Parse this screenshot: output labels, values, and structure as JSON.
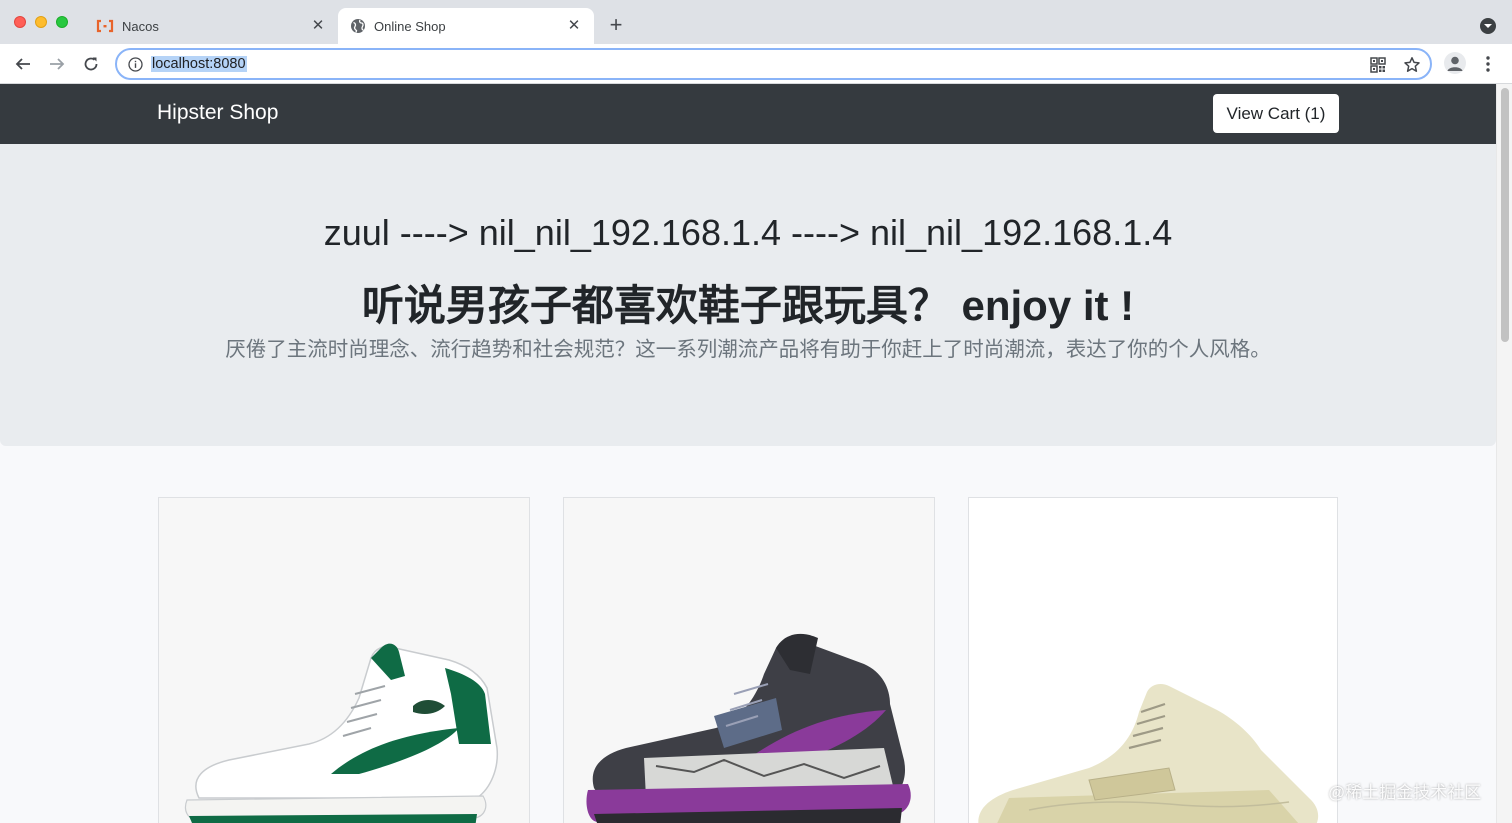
{
  "browser": {
    "tabs": [
      {
        "label": "Nacos",
        "icon": "nacos-logo-icon",
        "active": false
      },
      {
        "label": "Online Shop",
        "icon": "globe-icon",
        "active": true
      }
    ],
    "address_bar": {
      "url": "localhost:8080"
    }
  },
  "navbar": {
    "brand": "Hipster Shop",
    "cart_button": "View Cart (1)"
  },
  "hero": {
    "route": "zuul ----> nil_nil_192.168.1.4 ----> nil_nil_192.168.1.4",
    "title": "听说男孩子都喜欢鞋子跟玩具？ enjoy it !",
    "lead": "厌倦了主流时尚理念、流行趋势和社会规范？这一系列潮流产品将有助于你赶上了时尚潮流，表达了你的个人风格。"
  },
  "products": [
    {
      "image": "white-green-high-top-sneaker",
      "accent": "#0f6b45"
    },
    {
      "image": "grey-purple-basketball-sneaker",
      "accent": "#8a3a9a"
    },
    {
      "image": "cream-knit-runner-sneaker",
      "accent": "#e3e0b8"
    }
  ],
  "watermark": "@稀土掘金技术社区",
  "colors": {
    "navbar": "#353a3f",
    "hero": "#e9ecef",
    "page": "#f8f9fb",
    "omnibox_focus": "#8ab4f8"
  }
}
